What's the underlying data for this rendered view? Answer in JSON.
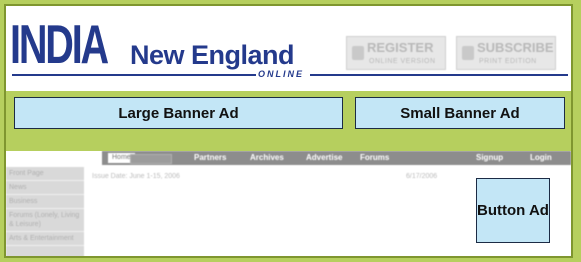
{
  "logo": {
    "india": "INDIA",
    "new_england": "New England",
    "online": "ONLINE"
  },
  "header_buttons": {
    "register": {
      "title": "REGISTER",
      "subtitle": "ONLINE VERSION"
    },
    "subscribe": {
      "title": "SUBSCRIBE",
      "subtitle": "PRINT EDITION"
    }
  },
  "ads": {
    "large": "Large Banner Ad",
    "small": "Small Banner Ad",
    "button": "Button Ad"
  },
  "nav": {
    "active": "Home",
    "items": [
      "Partners",
      "Archives",
      "Advertise",
      "Forums"
    ],
    "right_items": [
      "Signup",
      "Login"
    ]
  },
  "sidebar": {
    "items": [
      "Front Page",
      "News",
      "Business",
      "Forums (Lonely, Living & Leisure)",
      "Arts & Entertainment"
    ]
  },
  "content": {
    "issue_label": "Issue Date: June 1-15, 2006",
    "date": "6/17/2006"
  },
  "colors": {
    "page_bg": "#b6cf5e",
    "brand": "#243a8c",
    "ad_fill": "#c3e6f6"
  }
}
